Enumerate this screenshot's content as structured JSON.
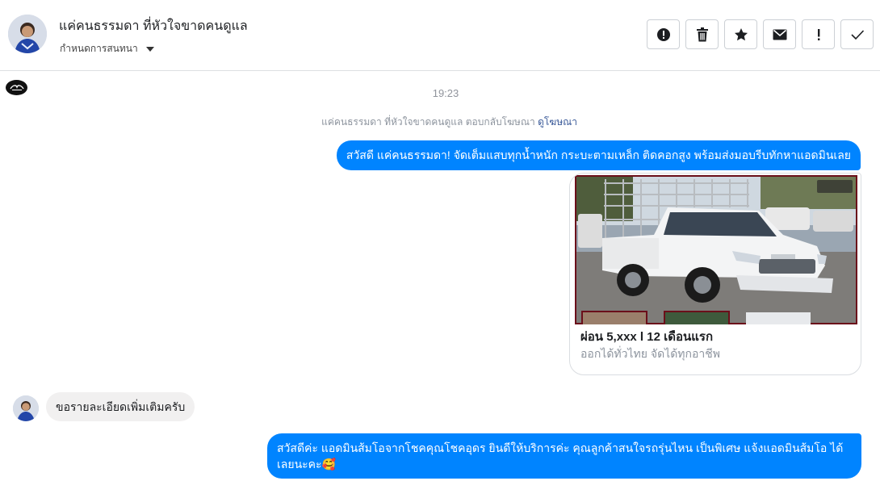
{
  "header": {
    "contact_name": "แค่คนธรรมดา ที่หัวใจขาดคนดูแล",
    "settings_label": "กำหนดการสนทนา",
    "toolbar": [
      {
        "icon": "alert-circle-icon",
        "label": "report"
      },
      {
        "icon": "trash-icon",
        "label": "delete"
      },
      {
        "icon": "star-icon",
        "label": "star"
      },
      {
        "icon": "envelope-icon",
        "label": "mark unread"
      },
      {
        "icon": "exclamation-icon",
        "label": "spam"
      },
      {
        "icon": "checkmark-icon",
        "label": "done"
      }
    ]
  },
  "thread": {
    "timestamp": "19:23",
    "replied_note": "แค่คนธรรมดา ที่หัวใจขาดคนดูแล ตอบกลับโฆษณา",
    "replied_link": "ดูโฆษณา",
    "messages": [
      {
        "from": "page",
        "text": "สวัสดี แค่คนธรรมดา! จัดเต็มแสบทุกน้ำหนัก กระบะตามเหล็ก ติดคอกสูง พร้อมส่งมอบรีบทักหาแอดมินเลย"
      },
      {
        "from": "page",
        "type": "ad",
        "title": "ผ่อน 5,xxx l 12 เดือนแรก",
        "subtitle": "ออกได้ทั่วไทย จัดได้ทุกอาชีพ"
      },
      {
        "from": "user",
        "text": "ขอรายละเอียดเพิ่มเติมครับ"
      },
      {
        "from": "page",
        "text": "สวัสดีค่ะ แอดมินส้มโอจากโชคคุณโชคอุดร ยินดีให้บริการค่ะ   คุณลูกค้าสนใจรถรุ่นไหน เป็นพิเศษ แจ้งแอดมินส้มโอ ได้เลยนะคะ🥰"
      }
    ]
  },
  "colors": {
    "outgoing_bubble": "#0084ff",
    "incoming_bubble": "#f1f0f0",
    "link": "#385898"
  }
}
